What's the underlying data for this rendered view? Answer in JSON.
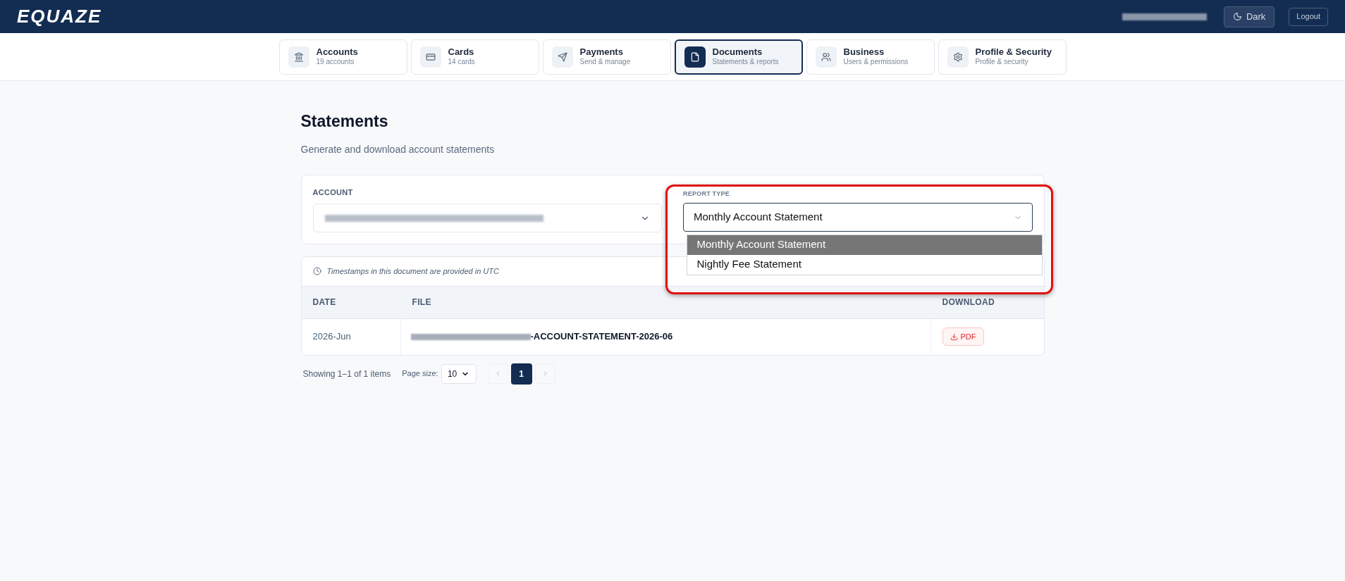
{
  "brand": "EQUAZE",
  "header": {
    "theme_button": "Dark",
    "logout_button": "Logout"
  },
  "nav_tabs": [
    {
      "label": "Accounts",
      "sublabel": "19 accounts",
      "selected": false
    },
    {
      "label": "Cards",
      "sublabel": "14 cards",
      "selected": false
    },
    {
      "label": "Payments",
      "sublabel": "Send & manage",
      "selected": false
    },
    {
      "label": "Documents",
      "sublabel": "Statements & reports",
      "selected": true
    },
    {
      "label": "Business",
      "sublabel": "Users & permissions",
      "selected": false
    },
    {
      "label": "Profile & Security",
      "sublabel": "Profile & security",
      "selected": false
    }
  ],
  "title": "Statements",
  "subtitle": "Generate and download account statements",
  "filters": {
    "account_label": "ACCOUNT",
    "report_type_label": "REPORT TYPE",
    "report_type_value": "Monthly Account Statement",
    "report_type_options": [
      {
        "label": "Monthly Account Statement",
        "selected": true
      },
      {
        "label": "Nightly Fee Statement",
        "selected": false
      }
    ]
  },
  "notice": "Timestamps in this document are provided in UTC",
  "table": {
    "columns": [
      "DATE",
      "FILE",
      "DOWNLOAD"
    ],
    "rows": [
      {
        "date": "2026-Jun",
        "file": "-ACCOUNT-STATEMENT-2026-06",
        "download": "PDF"
      }
    ]
  },
  "pagination": {
    "summary": "Showing 1–1 of 1 items",
    "page_size_label": "Page size:",
    "page_size": "10",
    "pages": [
      {
        "label": "1",
        "selected": true
      }
    ]
  }
}
